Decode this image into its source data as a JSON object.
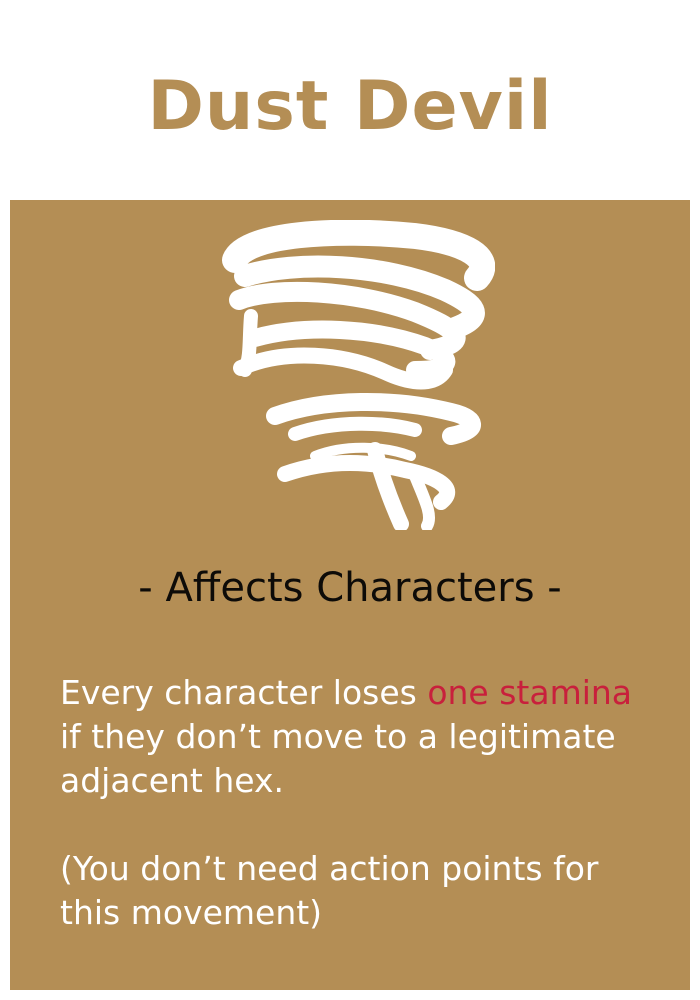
{
  "card": {
    "title": "Dust Devil",
    "icon": "tornado-icon",
    "subtitle": "- Affects Characters -",
    "rules_text": {
      "before": "Every character loses ",
      "highlight": "one stamina",
      "after": " if they don’t move to a legitimate adjacent hex."
    },
    "note": "(You don’t need action points for this movement)"
  },
  "colors": {
    "card_background": "#b48e55",
    "title": "#b48e55",
    "subtitle": "#0d0b08",
    "body_text": "#ffffff",
    "highlight": "#c8203c",
    "icon": "#ffffff"
  }
}
